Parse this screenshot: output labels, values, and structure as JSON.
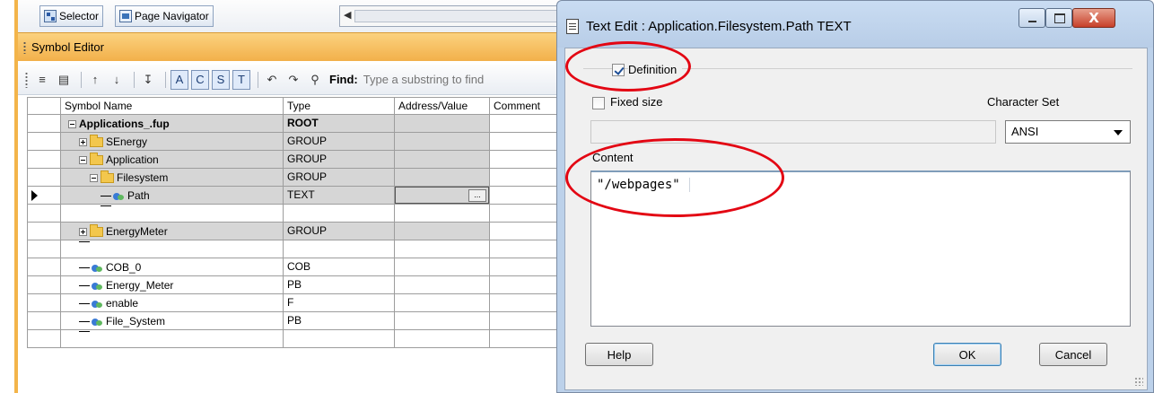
{
  "left_pane": {
    "tabs": [
      {
        "label": "Selector"
      },
      {
        "label": "Page Navigator"
      }
    ],
    "panel_title": "Symbol Editor",
    "toolbar": {
      "toggle_a": "A",
      "toggle_c": "C",
      "toggle_s": "S",
      "toggle_t": "T",
      "find_label": "Find:",
      "find_placeholder": "Type a substring to find"
    },
    "table": {
      "headers": [
        "Symbol Name",
        "Type",
        "Address/Value",
        "Comment"
      ],
      "rows": [
        {
          "name": "Applications_.fup",
          "type": "ROOT",
          "address": "",
          "comment": ""
        },
        {
          "name": "SEnergy",
          "type": "GROUP",
          "address": "",
          "comment": ""
        },
        {
          "name": "Application",
          "type": "GROUP",
          "address": "",
          "comment": ""
        },
        {
          "name": "Filesystem",
          "type": "GROUP",
          "address": "",
          "comment": ""
        },
        {
          "name": "Path",
          "type": "TEXT",
          "address": "",
          "comment": ""
        },
        {
          "name": "",
          "type": "",
          "address": "",
          "comment": ""
        },
        {
          "name": "EnergyMeter",
          "type": "GROUP",
          "address": "",
          "comment": ""
        },
        {
          "name": "",
          "type": "",
          "address": "",
          "comment": ""
        },
        {
          "name": "COB_0",
          "type": "COB",
          "address": "",
          "comment": ""
        },
        {
          "name": "Energy_Meter",
          "type": "PB",
          "address": "",
          "comment": ""
        },
        {
          "name": "enable",
          "type": "F",
          "address": "",
          "comment": ""
        },
        {
          "name": "File_System",
          "type": "PB",
          "address": "",
          "comment": ""
        },
        {
          "name": "",
          "type": "",
          "address": "",
          "comment": ""
        }
      ],
      "ellipsis_label": "..."
    }
  },
  "dialog": {
    "title": "Text Edit : Application.Filesystem.Path TEXT",
    "close_glyph": "X",
    "definition_label": "Definition",
    "definition_checked": true,
    "fixed_size_label": "Fixed size",
    "fixed_size_checked": false,
    "charset_label": "Character Set",
    "charset_value": "ANSI",
    "content_label": "Content",
    "content_value": "\"/webpages\"",
    "buttons": {
      "help": "Help",
      "ok": "OK",
      "cancel": "Cancel"
    }
  },
  "colors": {
    "annotation": "#e30613",
    "panel_header": "#f2b04a",
    "selection_row": "#d6d6d6"
  }
}
